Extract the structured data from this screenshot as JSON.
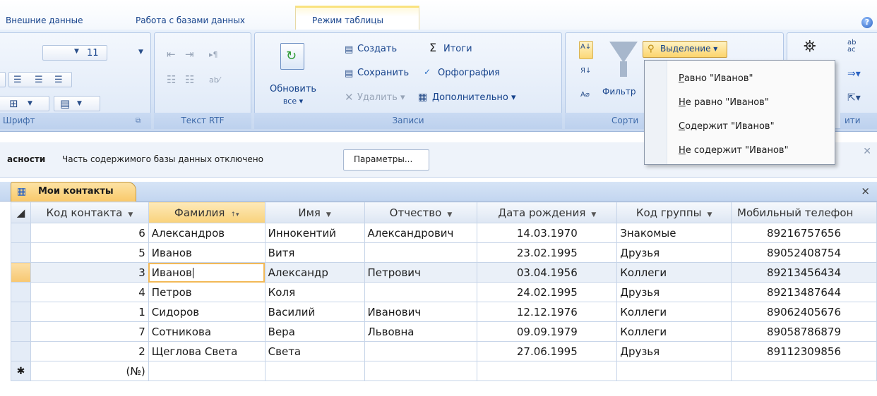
{
  "ribbon": {
    "tabs": [
      "Внешние данные",
      "Работа с базами данных",
      "Режим таблицы"
    ],
    "font_size": "11",
    "group_labels": {
      "font": "Шрифт",
      "rich_text": "Текст RTF",
      "records": "Записи",
      "sort": "Сорти",
      "find": "ити"
    },
    "refresh_label": "Обновить",
    "refresh_sub": "все ▾",
    "records": {
      "create": "Создать",
      "save": "Сохранить",
      "delete": "Удалить ▾",
      "totals": "Итоги",
      "spelling": "Орфография",
      "more": "Дополнительно ▾"
    },
    "filter_label": "Фильтр",
    "selection_label": "Выделение ▾"
  },
  "selection_menu": {
    "items": [
      {
        "key": "Р",
        "rest": "авно \"Иванов\""
      },
      {
        "key": "Н",
        "rest": "е равно \"Иванов\""
      },
      {
        "key": "С",
        "rest": "одержит \"Иванов\""
      },
      {
        "key": "Н",
        "rest": "е содержит \"Иванов\""
      }
    ]
  },
  "message_bar": {
    "title": "асности",
    "text": "Часть содержимого базы данных отключено",
    "button": "Параметры..."
  },
  "document": {
    "tab_title": "Мои контакты",
    "close": "×"
  },
  "table": {
    "columns": [
      "Код контакта",
      "Фамилия",
      "Имя",
      "Отчество",
      "Дата рождения",
      "Код группы",
      "Мобильный телефон"
    ],
    "rows": [
      {
        "id": "6",
        "last": "Александров",
        "first": "Иннокентий",
        "middle": "Александрович",
        "dob": "14.03.1970",
        "group": "Знакомые",
        "phone": "89216757656"
      },
      {
        "id": "5",
        "last": "Иванов",
        "first": "Витя",
        "middle": "",
        "dob": "23.02.1995",
        "group": "Друзья",
        "phone": "89052408754"
      },
      {
        "id": "3",
        "last": "Иванов",
        "first": "Александр",
        "middle": "Петрович",
        "dob": "03.04.1956",
        "group": "Коллеги",
        "phone": "89213456434"
      },
      {
        "id": "4",
        "last": "Петров",
        "first": "Коля",
        "middle": "",
        "dob": "24.02.1995",
        "group": "Друзья",
        "phone": "89213487644"
      },
      {
        "id": "1",
        "last": "Сидоров",
        "first": "Василий",
        "middle": "Иванович",
        "dob": "12.12.1976",
        "group": "Коллеги",
        "phone": "89062405676"
      },
      {
        "id": "7",
        "last": "Сотникова",
        "first": "Вера",
        "middle": "Львовна",
        "dob": "09.09.1979",
        "group": "Коллеги",
        "phone": "89058786879"
      },
      {
        "id": "2",
        "last": "Щеглова Света",
        "first": "Света",
        "middle": "",
        "dob": "27.06.1995",
        "group": "Друзья",
        "phone": "89112309856"
      }
    ],
    "new_row_marker": "✱",
    "new_row_id": "(№)"
  }
}
